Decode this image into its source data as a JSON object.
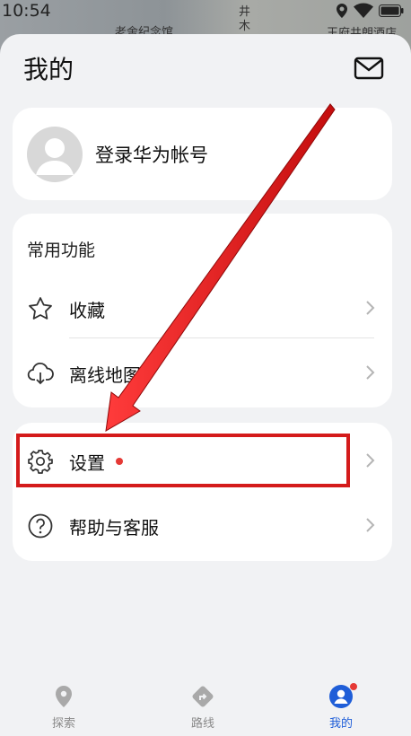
{
  "status_bar": {
    "time": "10:54"
  },
  "map_labels": [
    "老舍纪念馆",
    "井",
    "木",
    "王府井朗酒店"
  ],
  "header": {
    "title": "我的",
    "mail_icon": "mail-icon"
  },
  "login": {
    "text": "登录华为帐号",
    "avatar_icon": "default-avatar-icon"
  },
  "common": {
    "title": "常用功能",
    "items": [
      {
        "label": "收藏",
        "icon": "star-icon"
      },
      {
        "label": "离线地图",
        "icon": "cloud-download-icon"
      }
    ]
  },
  "more": {
    "items": [
      {
        "label": "设置",
        "icon": "gear-icon",
        "badge_dot": true
      },
      {
        "label": "帮助与客服",
        "icon": "question-icon"
      }
    ]
  },
  "bottom_nav": {
    "items": [
      {
        "label": "探索",
        "icon": "location-pin-icon",
        "active": false
      },
      {
        "label": "路线",
        "icon": "route-icon",
        "active": false
      },
      {
        "label": "我的",
        "icon": "user-icon",
        "active": true
      }
    ]
  },
  "colors": {
    "accent": "#1f5ed8",
    "dot": "#e53935",
    "annotation": "#d41b1b"
  }
}
